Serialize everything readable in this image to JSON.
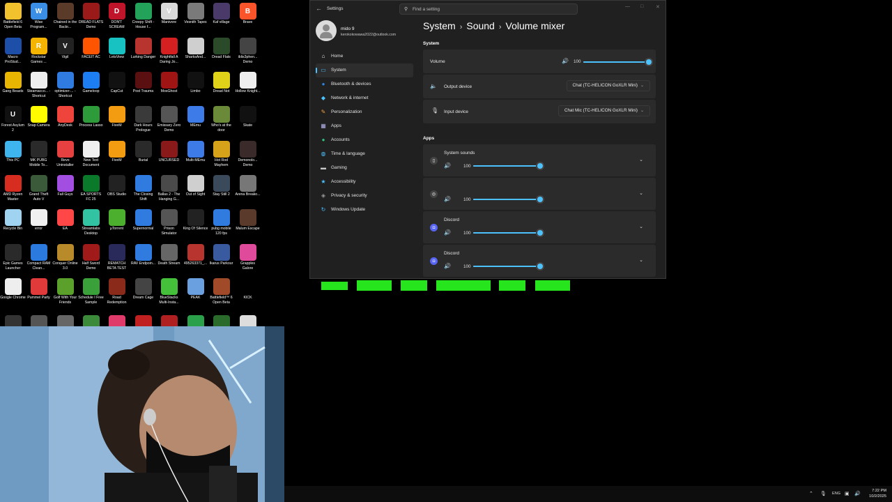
{
  "desktop": {
    "icons": [
      {
        "label": "Battlefield 6 Open Beta",
        "color": "#f2c12e",
        "glyph": ""
      },
      {
        "label": "Wise Program...",
        "color": "#3a8ee6",
        "glyph": "W"
      },
      {
        "label": "Chained in the Backr...",
        "color": "#5a3b2a",
        "glyph": ""
      },
      {
        "label": "DREAD FLATS Demo",
        "color": "#9a1a1a",
        "glyph": ""
      },
      {
        "label": "DON'T SCREAM",
        "color": "#c0142a",
        "glyph": "D"
      },
      {
        "label": "Creepy Shift - House f...",
        "color": "#23a35a",
        "glyph": ""
      },
      {
        "label": "Manivore",
        "color": "#d9d9d9",
        "glyph": "V"
      },
      {
        "label": "Vesnith Tapes",
        "color": "#7a7a7a",
        "glyph": ""
      },
      {
        "label": "Kaf village",
        "color": "#4a3a6a",
        "glyph": ""
      },
      {
        "label": "Brave",
        "color": "#fb542b",
        "glyph": "B"
      },
      {
        "label": "Macro ProStud...",
        "color": "#1e4fa8",
        "glyph": ""
      },
      {
        "label": "Rockstar Games ...",
        "color": "#f5b400",
        "glyph": "R"
      },
      {
        "label": "Vigil",
        "color": "#222",
        "glyph": "V"
      },
      {
        "label": "FACEIT AC",
        "color": "#ff5500",
        "glyph": ""
      },
      {
        "label": "LetsView",
        "color": "#19c2c2",
        "glyph": ""
      },
      {
        "label": "Lurking Danger",
        "color": "#b8342f",
        "glyph": ""
      },
      {
        "label": "Knightfall A Daring Jo...",
        "color": "#d42020",
        "glyph": ""
      },
      {
        "label": "SharksAnd...",
        "color": "#cfcfcf",
        "glyph": ""
      },
      {
        "label": "Dread Flats",
        "color": "#2a4a2a",
        "glyph": ""
      },
      {
        "label": "iblis3phen... Demo",
        "color": "#444",
        "glyph": ""
      },
      {
        "label": "Gang Beasts",
        "color": "#e8b500",
        "glyph": ""
      },
      {
        "label": "Steamacco... - Shortcut",
        "color": "#eeeeee",
        "glyph": ""
      },
      {
        "label": "optimizer-... - Shortcut",
        "color": "#2f7be0",
        "glyph": ""
      },
      {
        "label": "Gameloop",
        "color": "#1c7ef2",
        "glyph": ""
      },
      {
        "label": "CapCut",
        "color": "#111",
        "glyph": ""
      },
      {
        "label": "Post Trauma",
        "color": "#5a1010",
        "glyph": ""
      },
      {
        "label": "MosGhost",
        "color": "#a01414",
        "glyph": ""
      },
      {
        "label": "Limbo",
        "color": "#111",
        "glyph": ""
      },
      {
        "label": "Dread Not",
        "color": "#e0d218",
        "glyph": ""
      },
      {
        "label": "Hollow Knight...",
        "color": "#eeeeee",
        "glyph": ""
      },
      {
        "label": "Forest Asylum 2",
        "color": "#111",
        "glyph": "U"
      },
      {
        "label": "Snap Camera",
        "color": "#fffc00",
        "glyph": ""
      },
      {
        "label": "AnyDesk",
        "color": "#ef443b",
        "glyph": ""
      },
      {
        "label": "Process Lasso",
        "color": "#2e9b3a",
        "glyph": ""
      },
      {
        "label": "FiveM",
        "color": "#f39c12",
        "glyph": ""
      },
      {
        "label": "Dark Hours Prologue",
        "color": "#3a3a3a",
        "glyph": ""
      },
      {
        "label": "Emissary Zero Demo",
        "color": "#555",
        "glyph": ""
      },
      {
        "label": "MEmu",
        "color": "#3c7be8",
        "glyph": ""
      },
      {
        "label": "Who's at the door",
        "color": "#6a8a3a",
        "glyph": ""
      },
      {
        "label": "Skate",
        "color": "#111",
        "glyph": ""
      },
      {
        "label": "This PC",
        "color": "#3fb5f0",
        "glyph": ""
      },
      {
        "label": "MK PUBG Mobile To...",
        "color": "#2a2a2a",
        "glyph": ""
      },
      {
        "label": "Revo Uninstaller",
        "color": "#e64040",
        "glyph": ""
      },
      {
        "label": "New Text Document",
        "color": "#f0f0f0",
        "glyph": ""
      },
      {
        "label": "FiveM",
        "color": "#f39c12",
        "glyph": ""
      },
      {
        "label": "Burial",
        "color": "#2a2a2a",
        "glyph": ""
      },
      {
        "label": "UNCURSED",
        "color": "#8a1a1a",
        "glyph": ""
      },
      {
        "label": "Multi-MEmu",
        "color": "#3c7be8",
        "glyph": ""
      },
      {
        "label": "Hot Rod Mayhem",
        "color": "#d6a21a",
        "glyph": ""
      },
      {
        "label": "Demonolo... Demo",
        "color": "#3a2a2a",
        "glyph": ""
      },
      {
        "label": "AMD Ryzen Master",
        "color": "#d62d20",
        "glyph": ""
      },
      {
        "label": "Grand Theft Auto V",
        "color": "#3a5a3a",
        "glyph": ""
      },
      {
        "label": "Fall Guys",
        "color": "#a24ee0",
        "glyph": ""
      },
      {
        "label": "EA SPORTS FC 25",
        "color": "#0a7a2a",
        "glyph": ""
      },
      {
        "label": "OBS Studio",
        "color": "#222",
        "glyph": ""
      },
      {
        "label": "The Closing Shift",
        "color": "#2f7be0",
        "glyph": ""
      },
      {
        "label": "Ballas 2 - The Hanging G...",
        "color": "#4a4a4a",
        "glyph": ""
      },
      {
        "label": "Out of Sight",
        "color": "#cfcfcf",
        "glyph": ""
      },
      {
        "label": "Stay Still 2",
        "color": "#3a4a5a",
        "glyph": ""
      },
      {
        "label": "Arena Breako...",
        "color": "#777",
        "glyph": ""
      },
      {
        "label": "Recycle Bin",
        "color": "#9fd3f0",
        "glyph": ""
      },
      {
        "label": "error",
        "color": "#f0f0f0",
        "glyph": ""
      },
      {
        "label": "EA",
        "color": "#ff4747",
        "glyph": ""
      },
      {
        "label": "Streamlabs Desktop",
        "color": "#31c3a2",
        "glyph": ""
      },
      {
        "label": "µTorrent",
        "color": "#4caf2e",
        "glyph": ""
      },
      {
        "label": "Supernormal",
        "color": "#2f7be0",
        "glyph": ""
      },
      {
        "label": "Prison Simulator",
        "color": "#555",
        "glyph": ""
      },
      {
        "label": "King Of Silence",
        "color": "#222",
        "glyph": ""
      },
      {
        "label": "pubg mobile 120 fps",
        "color": "#2f7be0",
        "glyph": ""
      },
      {
        "label": "Malum Escape",
        "color": "#5a3a2a",
        "glyph": ""
      },
      {
        "label": "Epic Games Launcher",
        "color": "#2a2a2a",
        "glyph": ""
      },
      {
        "label": "Compact RAM Clean...",
        "color": "#2a7ae0",
        "glyph": ""
      },
      {
        "label": "Conquer Online 3.0",
        "color": "#b88a2a",
        "glyph": ""
      },
      {
        "label": "Half Sword Demo",
        "color": "#a01a1a",
        "glyph": ""
      },
      {
        "label": "REMATCH BETA TEST",
        "color": "#2a2a5a",
        "glyph": ""
      },
      {
        "label": "RAV Endpoin...",
        "color": "#2f7be0",
        "glyph": ""
      },
      {
        "label": "Death Stream",
        "color": "#666",
        "glyph": ""
      },
      {
        "label": "495263371_...",
        "color": "#b8342f",
        "glyph": ""
      },
      {
        "label": "Ikarus Parkour",
        "color": "#3a5aa0",
        "glyph": ""
      },
      {
        "label": "Grapples Galore",
        "color": "#e04a9a",
        "glyph": ""
      },
      {
        "label": "Google Chrome",
        "color": "#eeeeee",
        "glyph": ""
      },
      {
        "label": "Pummel Party",
        "color": "#e03a3a",
        "glyph": ""
      },
      {
        "label": "Golf With Your Friends",
        "color": "#5aa02a",
        "glyph": ""
      },
      {
        "label": "Schedule I Free Sample",
        "color": "#3aa03a",
        "glyph": ""
      },
      {
        "label": "Road Redemption",
        "color": "#8a2a1a",
        "glyph": ""
      },
      {
        "label": "Dream Cage",
        "color": "#444",
        "glyph": ""
      },
      {
        "label": "BlueStacks Multi-Insta...",
        "color": "#45c03a",
        "glyph": ""
      },
      {
        "label": "PEAK",
        "color": "#6aa0e0",
        "glyph": ""
      },
      {
        "label": "Battlefield™ 6 Open Beta",
        "color": "#a04a2a",
        "glyph": ""
      },
      {
        "label": "KICK",
        "color": "#000",
        "glyph": ""
      }
    ]
  },
  "settings": {
    "app_title": "Settings",
    "search_placeholder": "Find a setting",
    "profile": {
      "name": "mido 9",
      "email": "kerokokowawa2022@outlook.com"
    },
    "nav": [
      {
        "label": "Home",
        "icon": "home-icon",
        "glyph": "⌂",
        "color": "#e6e6e6"
      },
      {
        "label": "System",
        "icon": "system-icon",
        "glyph": "▭",
        "color": "#4cc2ff",
        "active": true
      },
      {
        "label": "Bluetooth & devices",
        "icon": "bluetooth-icon",
        "glyph": "●",
        "color": "#2f86e0"
      },
      {
        "label": "Network & internet",
        "icon": "network-icon",
        "glyph": "◆",
        "color": "#4cc2ff"
      },
      {
        "label": "Personalization",
        "icon": "brush-icon",
        "glyph": "✎",
        "color": "#f0a040"
      },
      {
        "label": "Apps",
        "icon": "apps-icon",
        "glyph": "▦",
        "color": "#b0b0e8"
      },
      {
        "label": "Accounts",
        "icon": "accounts-icon",
        "glyph": "●",
        "color": "#30c080"
      },
      {
        "label": "Time & language",
        "icon": "globe-icon",
        "glyph": "◍",
        "color": "#4cc2ff"
      },
      {
        "label": "Gaming",
        "icon": "gaming-icon",
        "glyph": "▬",
        "color": "#c8c8c8"
      },
      {
        "label": "Accessibility",
        "icon": "accessibility-icon",
        "glyph": "★",
        "color": "#4cc2ff"
      },
      {
        "label": "Privacy & security",
        "icon": "shield-icon",
        "glyph": "◈",
        "color": "#9a9a9a"
      },
      {
        "label": "Windows Update",
        "icon": "update-icon",
        "glyph": "↻",
        "color": "#4cc2ff"
      }
    ],
    "breadcrumb": [
      "System",
      "Sound",
      "Volume mixer"
    ],
    "system_section": "System",
    "volume": {
      "label": "Volume",
      "value": "100",
      "level": 1.0
    },
    "output": {
      "label": "Output device",
      "value": "Chat (TC-HELICON GoXLR Mini)"
    },
    "input": {
      "label": "Input device",
      "value": "Chat Mic (TC-HELICON GoXLR Mini)"
    },
    "apps_section": "Apps",
    "apps": [
      {
        "name": "System sounds",
        "value": "100",
        "level": 1.0,
        "icon": "system-sounds-icon",
        "glyph": "▯",
        "color": "#444"
      },
      {
        "name": "",
        "value": "100",
        "level": 1.0,
        "icon": "app-icon",
        "glyph": "◎",
        "color": "#444"
      },
      {
        "name": "Discord",
        "value": "100",
        "level": 1.0,
        "icon": "discord-icon",
        "glyph": "◘",
        "color": "#5865f2"
      },
      {
        "name": "Discord",
        "value": "100",
        "level": 1.0,
        "icon": "discord-icon",
        "glyph": "◘",
        "color": "#5865f2"
      }
    ]
  },
  "taskbar": {
    "lang": "ENG",
    "time": "7:22 PM",
    "date": "10/2/2025"
  },
  "colors": {
    "accent": "#4cc2ff",
    "green_bars": "#27e51d"
  }
}
